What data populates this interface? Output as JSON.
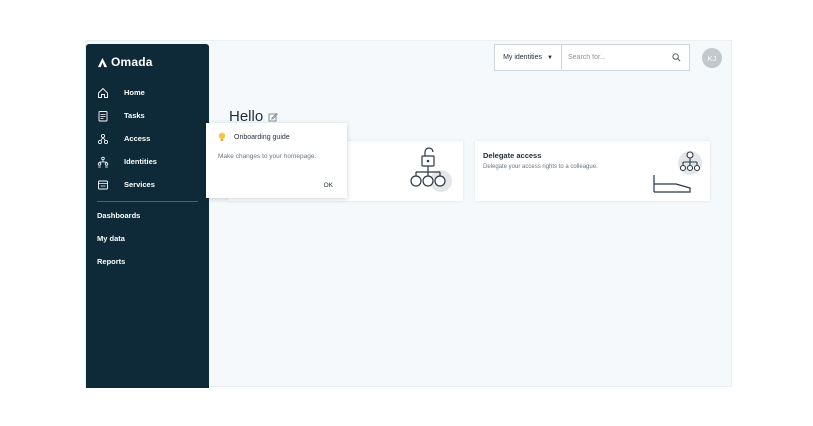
{
  "brand": {
    "name": "Omada"
  },
  "sidebar": {
    "items": [
      {
        "label": "Home",
        "icon": "home-icon"
      },
      {
        "label": "Tasks",
        "icon": "tasks-icon"
      },
      {
        "label": "Access",
        "icon": "access-icon"
      },
      {
        "label": "Identities",
        "icon": "identities-icon"
      },
      {
        "label": "Services",
        "icon": "services-icon"
      }
    ],
    "secondary": [
      {
        "label": "Dashboards"
      },
      {
        "label": "My data"
      },
      {
        "label": "Reports"
      }
    ]
  },
  "header": {
    "scope_select": "My identities",
    "search_placeholder": "Search for...",
    "avatar_initials": "KJ"
  },
  "main": {
    "greeting": "Hello",
    "cards": [
      {
        "title": "",
        "description": ""
      },
      {
        "title": "Delegate access",
        "description": "Delegate your access rights to a colleague."
      }
    ]
  },
  "popover": {
    "title": "Onboarding guide",
    "body": "Make changes to your homepage.",
    "ok_label": "OK"
  },
  "colors": {
    "sidebar_bg": "#0e2a38",
    "page_bg": "#f5f9fc",
    "accent_bulb": "#f2c744"
  }
}
